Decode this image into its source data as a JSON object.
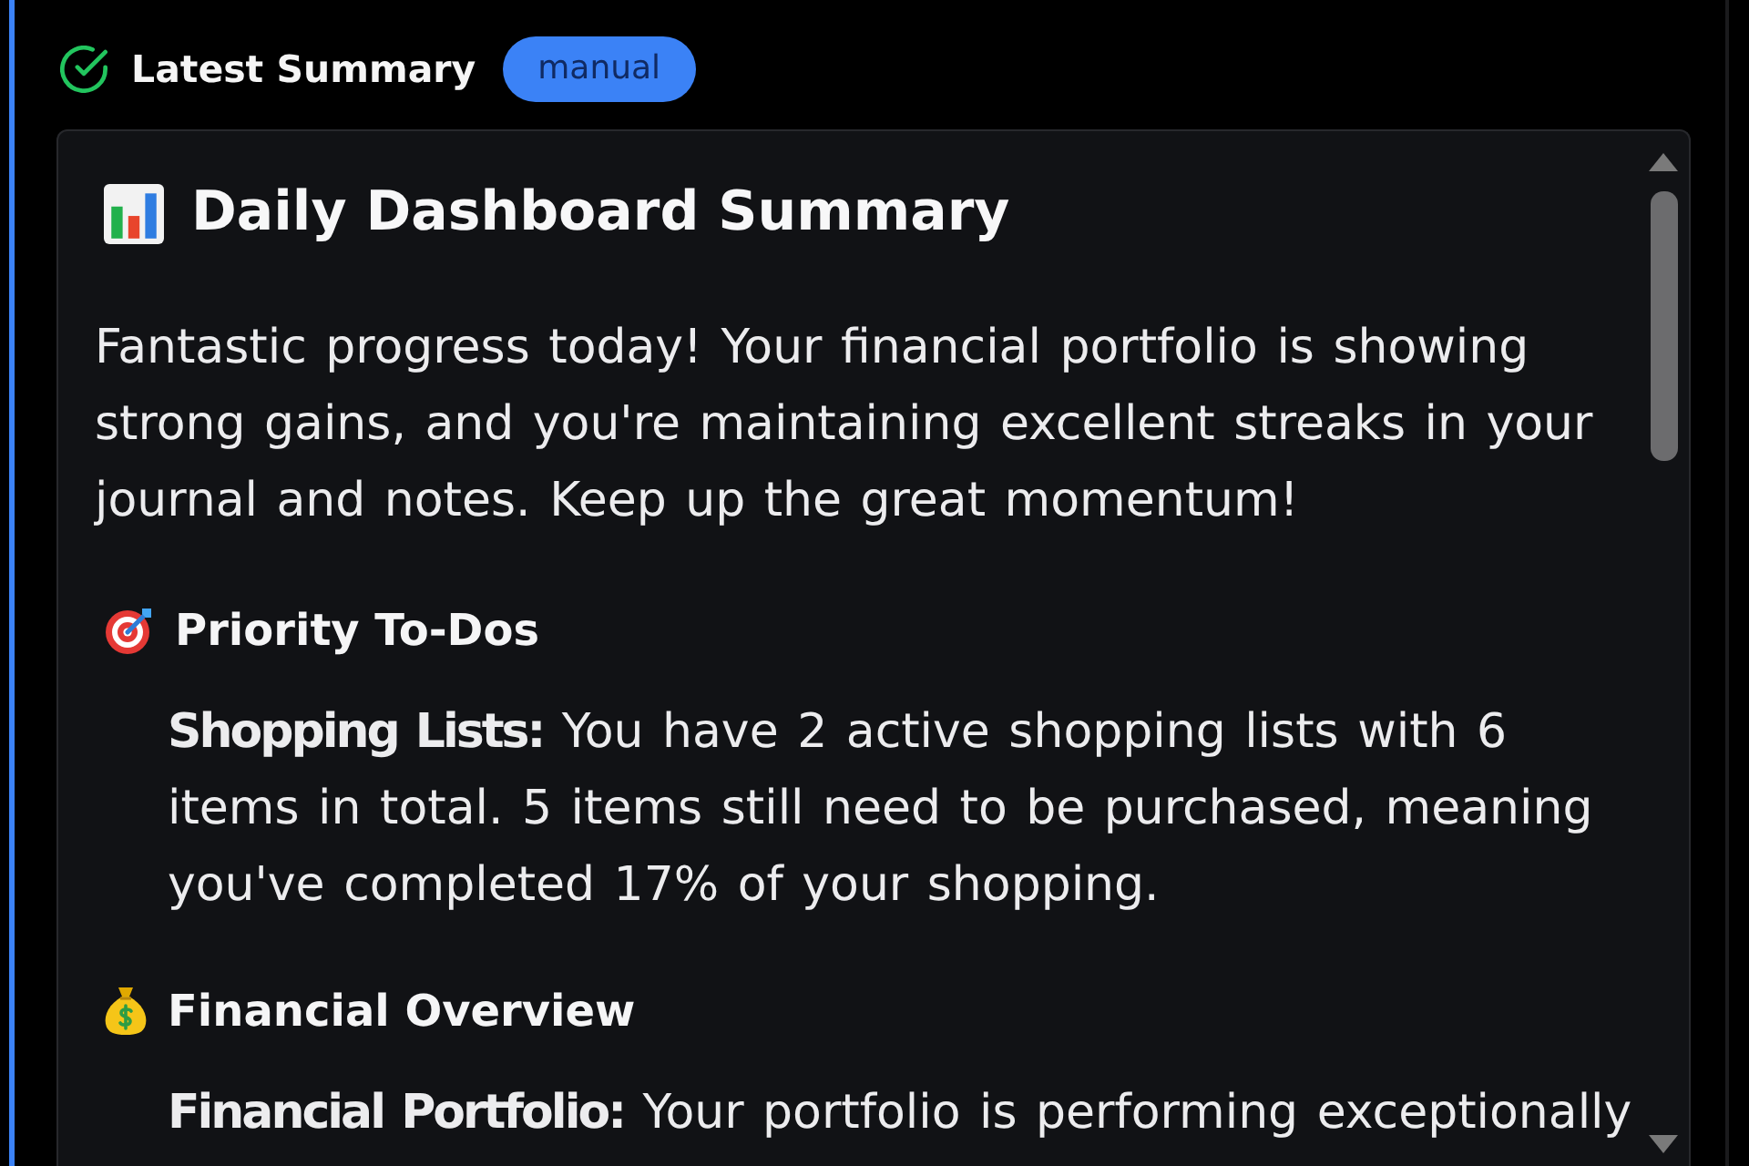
{
  "header": {
    "title": "Latest Summary",
    "badge": "manual"
  },
  "summary": {
    "title": "Daily Dashboard Summary",
    "intro": "Fantastic progress today! Your financial portfolio is showing strong gains, and you're maintaining excellent streaks in your journal and notes. Keep up the great momentum!",
    "sections": [
      {
        "heading": "Priority To-Dos",
        "paragraphs": [
          "**Shopping Lists:** You have 2 active shopping lists with 6 items in total. 5 items still need to be purchased, meaning you've completed 17% of your shopping."
        ]
      },
      {
        "heading": "Financial Overview",
        "paragraphs": [
          "**Financial Portfolio:** Your portfolio is performing exceptionally"
        ]
      }
    ]
  }
}
